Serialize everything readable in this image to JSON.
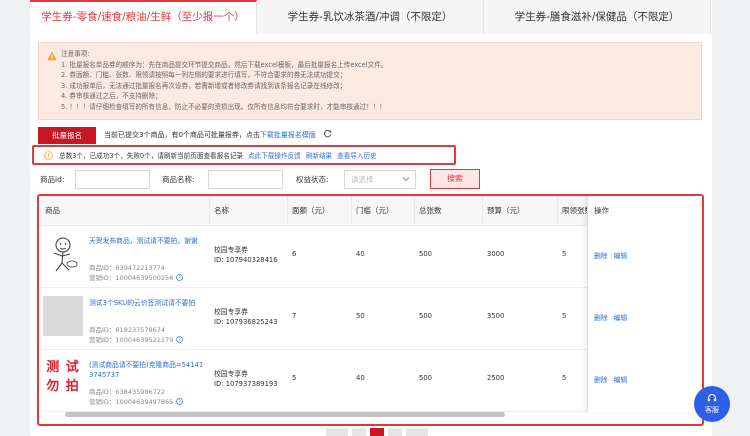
{
  "tabs": [
    {
      "label": "学生券-零食/速食/粮油/生鲜（至少报一个）",
      "active": true
    },
    {
      "label": "学生券-乳饮冰茶酒/冲调（不限定）",
      "active": false
    },
    {
      "label": "学生券-膳食滋补/保健品（不限定）",
      "active": false
    }
  ],
  "notice": {
    "title": "注意事项:",
    "items": [
      "1. 批量报名单品券的顺序为：先在商品提交环节提交商品，然后下载excel模板，最后批量报名上传excel文件。",
      "2. 券面额、门槛、张数、限领请按照每一列左侧的要求进行填写，不符合要求的券无法成功提交；",
      "3. 成功报单后，无法通过批量报名再次设券，若需新增或者修改券请找到该条报名记录在线修改；",
      "4. 券审核通过之后，不支持删除；",
      "5. ！！！请仔细检查填写的所有信息，防止不必要的资损出现。仅所有信息均符合要求时，才能审核通过！！！"
    ]
  },
  "batch": {
    "button_label": "批量报名",
    "info_text": "当前已提交3个商品，有0个商品可批量报券，点击",
    "download_link": "下载批量报名模版"
  },
  "status": {
    "text": "总数3个，已成功3个，失败0个，请刷新当前页面查看报名记录",
    "feedback_link": "点此下载操作反馈",
    "refresh_link": "刷新结果",
    "history_link": "查看导入历史"
  },
  "filters": {
    "product_id_label": "商品id:",
    "product_name_label": "商品名称:",
    "rights_status_label": "权益状态:",
    "rights_status_placeholder": "请选择",
    "search_button": "搜索"
  },
  "table": {
    "headers": [
      "商品",
      "名称",
      "面额（元）",
      "门槛（元）",
      "总张数",
      "预算（元）",
      "限领张数",
      "操作"
    ],
    "rows": [
      {
        "title": "天贺发布商品，测试请不要拍，谢谢",
        "product_id": "商品ID：639472213774",
        "marketing_id": "营销ID：10004639500256",
        "coupon_name": "校园专享券",
        "coupon_id": "ID: 107940328416",
        "face_value": "6",
        "threshold": "40",
        "total": "500",
        "budget": "3000",
        "limit": "5",
        "thumb": "doodle"
      },
      {
        "title": "测试3个SKU的云价签测试请不要拍",
        "product_id": "商品ID：618237578674",
        "marketing_id": "营销ID：10004639521179",
        "coupon_name": "校园专享券",
        "coupon_id": "ID: 107936825243",
        "face_value": "7",
        "threshold": "50",
        "total": "500",
        "budget": "3500",
        "limit": "5",
        "thumb": "grey"
      },
      {
        "title": "(测试商品请不要拍)克隆商品=541413745737",
        "product_id": "商品ID：638435986722",
        "marketing_id": "营销ID：10004639497865",
        "coupon_name": "校园专享券",
        "coupon_id": "ID: 107937389193",
        "face_value": "5",
        "threshold": "40",
        "total": "500",
        "budget": "2500",
        "limit": "5",
        "thumb": "text",
        "thumb_text": "测 试 勿 拍"
      }
    ],
    "ops": {
      "delete": "删除",
      "edit": "编辑"
    }
  },
  "support": {
    "label": "客服"
  },
  "colors": {
    "accent": "#e4393c",
    "link": "#2e6ed6",
    "brand_button": "#c81623",
    "support": "#2d5fe8"
  }
}
